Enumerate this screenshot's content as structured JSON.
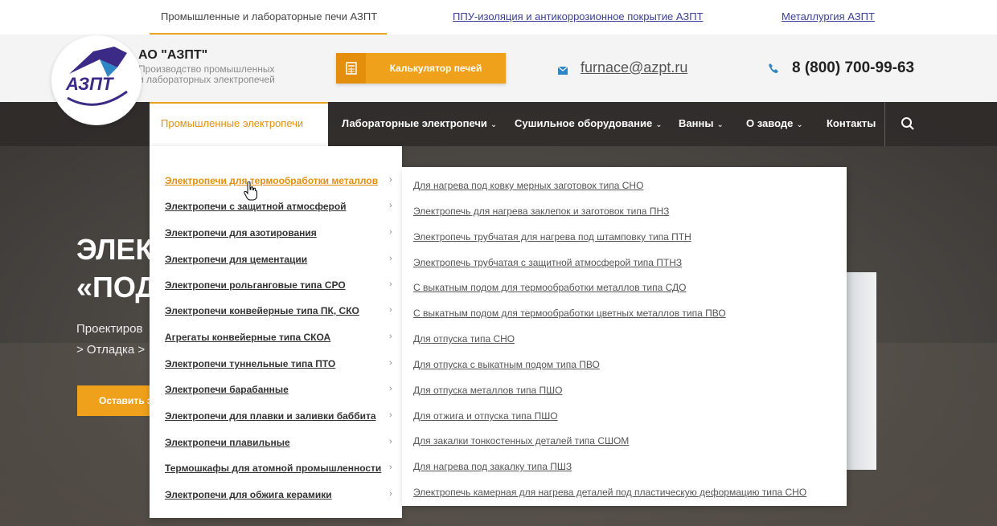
{
  "top_links": [
    {
      "label": "Промышленные и лабораторные печи АЗПТ"
    },
    {
      "label": "ППУ-изоляция и антикоррозионное покрытие АЗПТ"
    },
    {
      "label": "Металлургия АЗПТ"
    }
  ],
  "header": {
    "brand_name": "АО \"АЗПТ\"",
    "brand_sub_1": "Производство промышленных",
    "brand_sub_2": "и лабораторных электропечей",
    "logo_text": "АЗПТ",
    "calc_button": "Калькулятор печей",
    "email": "furnace@azpt.ru",
    "phone": "8 (800) 700-99-63",
    "icons": {
      "calc": "calculator-icon",
      "mail": "mail-icon",
      "phone": "phone-icon",
      "search": "search-icon"
    },
    "accent_color": "#f0a11b"
  },
  "nav": {
    "items": [
      {
        "label": "Промышленные электропечи",
        "has_dropdown": false
      },
      {
        "label": "Лабораторные электропечи",
        "has_dropdown": true
      },
      {
        "label": "Сушильное оборудование",
        "has_dropdown": true
      },
      {
        "label": "Ванны",
        "has_dropdown": true
      },
      {
        "label": "О заводе",
        "has_dropdown": true
      },
      {
        "label": "Контакты",
        "has_dropdown": false
      }
    ],
    "chevron": "⌄"
  },
  "hero": {
    "title_1": "ЭЛЕК",
    "title_2": "«ПОД",
    "sub_1": "Проектиров",
    "sub_2": "> Отладка >",
    "button": "Оставить з"
  },
  "dropdown": {
    "left_items": [
      "Электропечи для термообработки металлов",
      "Электропечи с защитной атмосферой",
      "Электропечи для азотирования",
      "Электропечи для цементации",
      "Электропечи рольганговые типа СРО",
      "Электропечи конвейерные типа ПК, СКО",
      "Агрегаты конвейерные типа СКОА",
      "Электропечи туннельные типа ПТО",
      "Электропечи барабанные",
      "Электропечи для плавки и заливки баббита",
      "Электропечи плавильные",
      "Термошкафы для атомной промышленности",
      "Электропечи для обжига керамики"
    ],
    "right_items": [
      "Для нагрева под ковку мерных заготовок типа СНО",
      "Электропечь для нагрева заклепок и заготовок типа ПНЗ",
      "Электропечь трубчатая для нагрева под штамповку типа ПТН",
      "Электропечь трубчатая с защитной атмосферой типа ПТНЗ",
      "С выкатным подом для термообработки металлов типа СДО",
      "С выкатным подом для термообработки цветных металлов типа ПВО",
      "Для отпуска типа СНО",
      "Для отпуска с выкатным подом типа ПВО",
      "Для отпуска металлов типа ПШО",
      "Для отжига и отпуска типа ПШО",
      "Для закалки тонкостенных деталей типа СШОМ",
      "Для нагрева под закалку типа ПШЗ",
      "Электропечь камерная для нагрева деталей под пластическую деформацию типа СНО"
    ],
    "chevron": "›"
  }
}
